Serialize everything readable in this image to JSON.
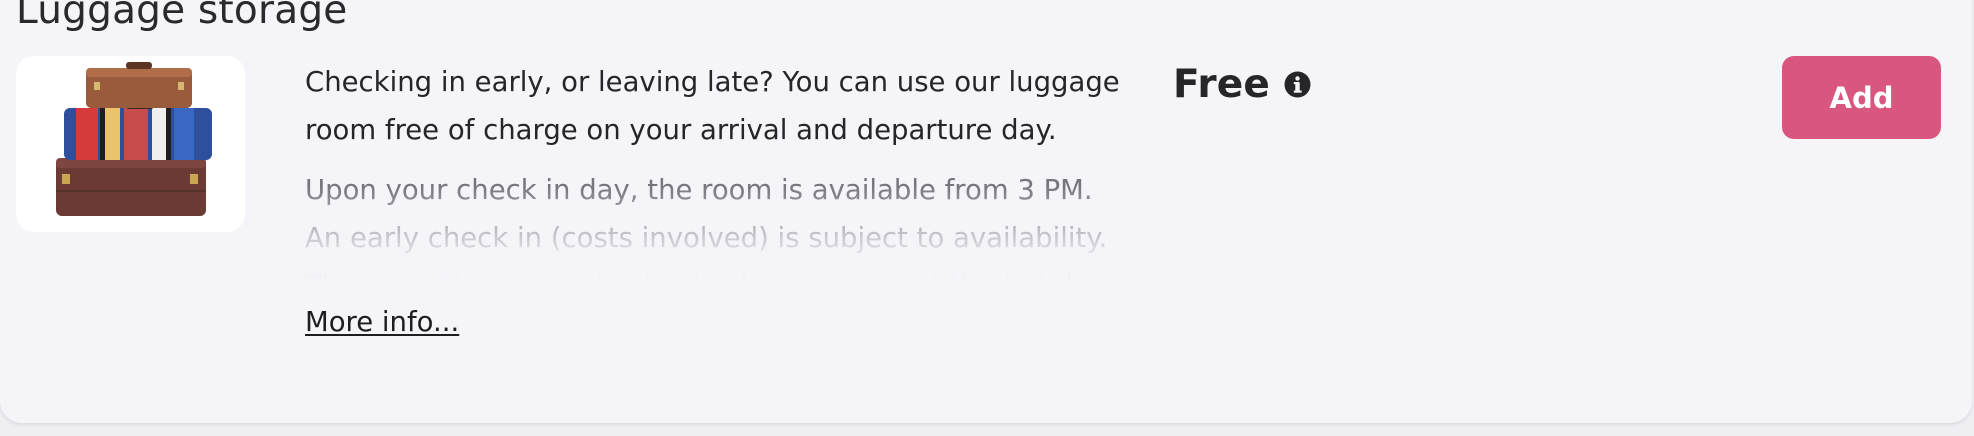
{
  "section": {
    "title": "Luggage storage",
    "image_alt": "stacked-vintage-suitcases"
  },
  "description": {
    "main": "Checking in early, or leaving late? You can use our luggage room free of charge on your arrival and departure day.",
    "more": "Upon your check in day, the room is available from 3 PM. An early check in (costs involved) is subject to availability. The reception can only check when you are at the hotel where a",
    "more_link": "More info..."
  },
  "price": {
    "label": "Free",
    "info_icon": "info-circle-icon"
  },
  "actions": {
    "add_label": "Add"
  },
  "colors": {
    "accent": "#d9567f",
    "card_bg": "#f4f4f9",
    "text": "#26262a",
    "muted_text": "#76767c"
  }
}
